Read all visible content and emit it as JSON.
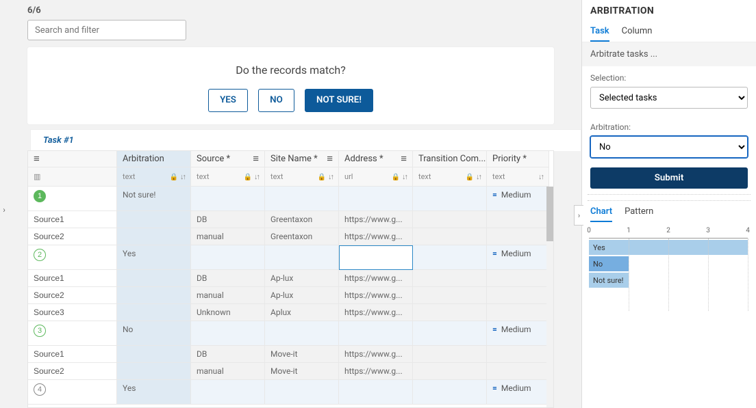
{
  "topbar": {
    "counter": "6/6",
    "search_placeholder": "Search and filter"
  },
  "card": {
    "question": "Do the records match?",
    "yes": "YES",
    "no": "NO",
    "not_sure": "NOT SURE!"
  },
  "task_tab": "Task #1",
  "columns": [
    {
      "title": "",
      "sub": "",
      "icon": "≡",
      "subicon": "▥"
    },
    {
      "title": "Arbitration",
      "sub": "text",
      "lock": true,
      "sort": true
    },
    {
      "title": "Source *",
      "sub": "text",
      "lock": true,
      "sort": true,
      "menu": true
    },
    {
      "title": "Site Name *",
      "sub": "text",
      "lock": true,
      "sort": true,
      "menu": true
    },
    {
      "title": "Address *",
      "sub": "url",
      "lock": true,
      "sort": true,
      "menu": true
    },
    {
      "title": "Transition Com...",
      "sub": "text",
      "lock": true,
      "sort": true
    },
    {
      "title": "Priority *",
      "sub": "text",
      "sort": true
    }
  ],
  "rows": [
    {
      "type": "head",
      "num": "1",
      "num_style": "fill",
      "arb": "Not sure!",
      "prio": "Medium"
    },
    {
      "type": "src",
      "label": "Source1",
      "source": "DB",
      "site": "Greentaxon",
      "addr": "https://www.g..."
    },
    {
      "type": "src",
      "label": "Source2",
      "source": "manual",
      "site": "Greentaxon",
      "addr": "https://www.g..."
    },
    {
      "type": "head",
      "num": "2",
      "num_style": "out",
      "arb": "Yes",
      "prio": "Medium",
      "addr_selected": true
    },
    {
      "type": "src",
      "label": "Source1",
      "source": "DB",
      "site": "Ap-lux",
      "addr": "https://www.g..."
    },
    {
      "type": "src",
      "label": "Source2",
      "source": "manual",
      "site": "Ap-lux",
      "addr": "https://www.g..."
    },
    {
      "type": "src",
      "label": "Source3",
      "source": "Unknown",
      "site": "Aplux",
      "addr": "https://www.g..."
    },
    {
      "type": "head",
      "num": "3",
      "num_style": "out",
      "arb": "No",
      "prio": "Medium"
    },
    {
      "type": "src",
      "label": "Source1",
      "source": "DB",
      "site": "Move-it",
      "addr": "https://www.g..."
    },
    {
      "type": "src",
      "label": "Source2",
      "source": "manual",
      "site": "Move-it",
      "addr": "https://www.g..."
    },
    {
      "type": "head",
      "num": "4",
      "num_style": "grey",
      "arb": "Yes",
      "prio": "Medium"
    }
  ],
  "side": {
    "title": "ARBITRATION",
    "tabs": {
      "task": "Task",
      "column": "Column",
      "active": "task"
    },
    "sub": "Arbitrate tasks ...",
    "selection_label": "Selection:",
    "selection_value": "Selected tasks",
    "arbitration_label": "Arbitration:",
    "arbitration_value": "No",
    "submit": "Submit",
    "chart_tabs": {
      "chart": "Chart",
      "pattern": "Pattern",
      "active": "chart"
    }
  },
  "chart_data": {
    "type": "bar",
    "orientation": "horizontal",
    "categories": [
      "Yes",
      "No",
      "Not sure!"
    ],
    "values": [
      4,
      1,
      1
    ],
    "selected": 1,
    "xlabel": "",
    "ylabel": "",
    "xlim": [
      0,
      4
    ],
    "ticks": [
      0,
      1,
      2,
      3,
      4
    ]
  }
}
